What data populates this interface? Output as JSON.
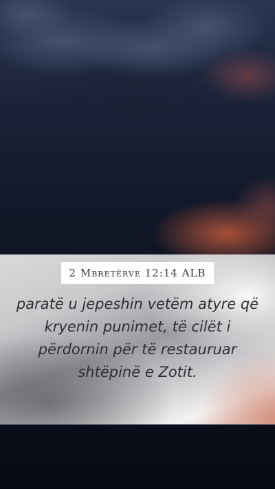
{
  "verse": {
    "reference": "2 Mbretërve 12:14 ALB",
    "text": "paratë u jepeshin vetëm atyre që kryenin punimet, të cilët i përdornin për të restauruar shtëpinë e Zotit."
  },
  "colors": {
    "sky_top": "#2a3550",
    "sky_bottom": "#080a14",
    "cloud_glow": "#b4503a",
    "panel_text": "#2f2f33",
    "badge_bg": "#ffffff"
  }
}
